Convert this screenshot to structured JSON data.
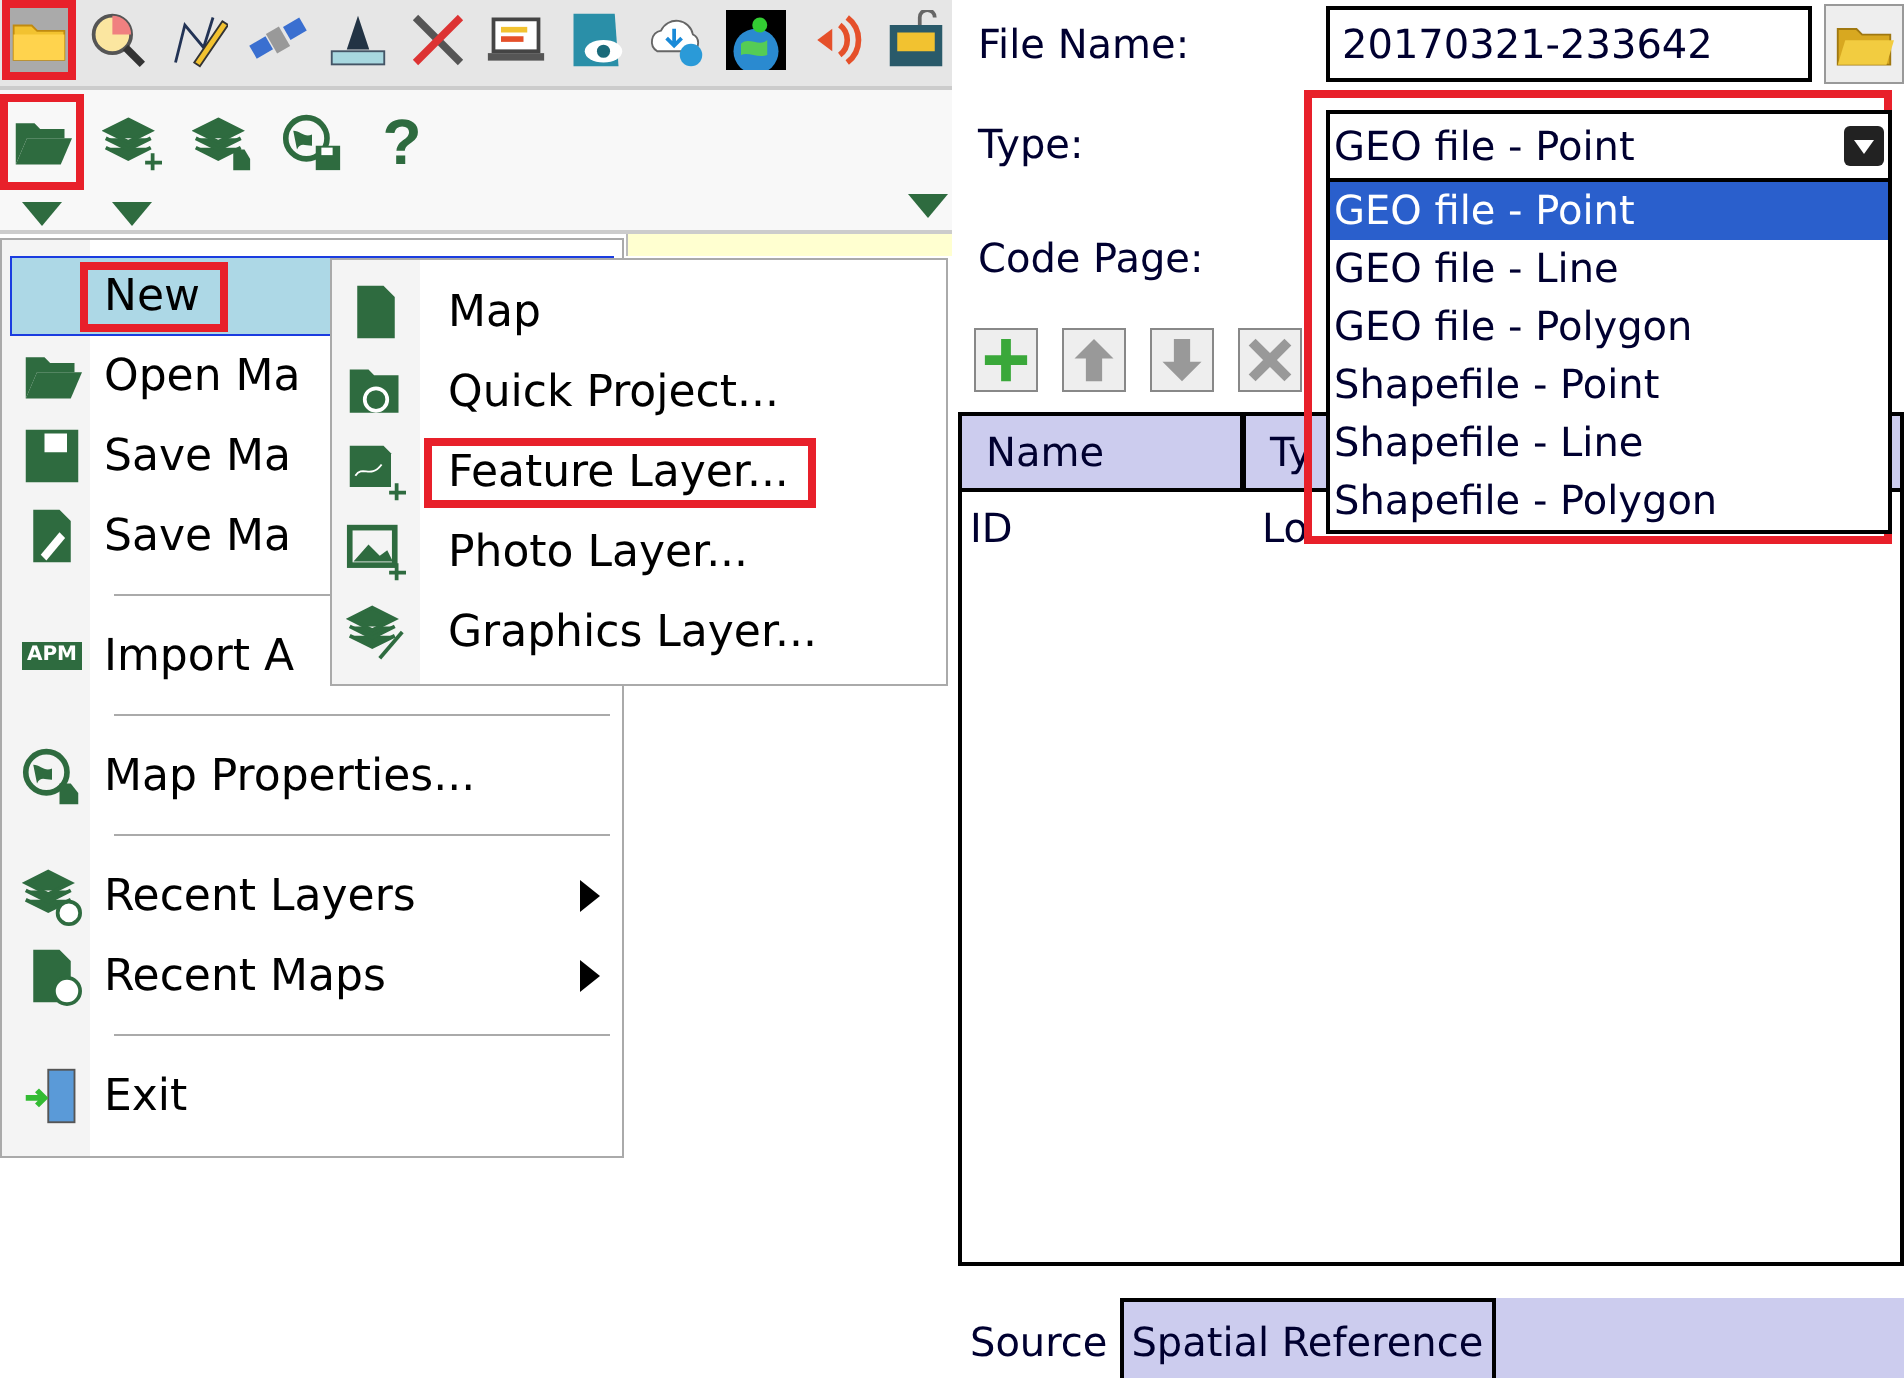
{
  "toolbar_top": [
    {
      "kind": "folder",
      "highlighted": true
    },
    {
      "kind": "magnifier",
      "highlighted": false
    },
    {
      "kind": "pencil",
      "highlighted": false
    },
    {
      "kind": "satellite",
      "highlighted": false
    },
    {
      "kind": "ruler",
      "highlighted": false
    },
    {
      "kind": "tools",
      "highlighted": false
    },
    {
      "kind": "laptop",
      "highlighted": false
    },
    {
      "kind": "eye",
      "highlighted": false
    },
    {
      "kind": "cloud",
      "highlighted": false
    },
    {
      "kind": "globe",
      "highlighted": false
    },
    {
      "kind": "signal",
      "highlighted": false
    },
    {
      "kind": "lock",
      "highlighted": false
    }
  ],
  "toolbar_second": [
    {
      "kind": "folder-open",
      "highlighted": true,
      "dropdown": true
    },
    {
      "kind": "layers-add",
      "highlighted": false,
      "dropdown": true
    },
    {
      "kind": "layers-edit",
      "highlighted": false,
      "dropdown": false
    },
    {
      "kind": "globe-save",
      "highlighted": false,
      "dropdown": false
    },
    {
      "kind": "help",
      "label": "?",
      "highlighted": false,
      "dropdown": false
    }
  ],
  "file_menu": {
    "items": [
      {
        "kind": "new",
        "label": "New",
        "selected": true,
        "highlighted": true,
        "has_submenu": false
      },
      {
        "kind": "folder",
        "label": "Open Ma",
        "selected": false,
        "highlighted": false,
        "has_submenu": false
      },
      {
        "kind": "save",
        "label": "Save Ma",
        "selected": false,
        "highlighted": false,
        "has_submenu": false
      },
      {
        "kind": "edit",
        "label": "Save Ma",
        "selected": false,
        "highlighted": false,
        "has_submenu": false
      },
      {
        "kind": "separator"
      },
      {
        "kind": "apm",
        "icon_text": "APM",
        "label": "Import A",
        "selected": false,
        "highlighted": false,
        "has_submenu": false
      },
      {
        "kind": "separator"
      },
      {
        "kind": "globe",
        "label": "Map Properties...",
        "selected": false,
        "highlighted": false,
        "has_submenu": false
      },
      {
        "kind": "separator"
      },
      {
        "kind": "layers-clock",
        "label": "Recent Layers",
        "selected": false,
        "highlighted": false,
        "has_submenu": true
      },
      {
        "kind": "document-clock",
        "label": "Recent Maps",
        "selected": false,
        "highlighted": false,
        "has_submenu": true
      },
      {
        "kind": "separator"
      },
      {
        "kind": "exit",
        "label": "Exit",
        "selected": false,
        "highlighted": false,
        "has_submenu": false
      }
    ]
  },
  "new_submenu": {
    "items": [
      {
        "kind": "document",
        "label": "Map",
        "highlighted": false
      },
      {
        "kind": "folder-clock",
        "label": "Quick Project...",
        "highlighted": false
      },
      {
        "kind": "feature",
        "label": "Feature Layer...",
        "highlighted": true
      },
      {
        "kind": "photo",
        "label": "Photo Layer...",
        "highlighted": false
      },
      {
        "kind": "layers-brush",
        "label": "Graphics Layer...",
        "highlighted": false
      }
    ]
  },
  "form": {
    "file_name": {
      "label": "File Name:",
      "value": "20170321-233642"
    },
    "type": {
      "label": "Type:",
      "value": "GEO file - Point",
      "highlighted": true,
      "expanded": true,
      "options": [
        {
          "label": "GEO file - Point",
          "selected": true
        },
        {
          "label": "GEO file - Line",
          "selected": false
        },
        {
          "label": "GEO file - Polygon",
          "selected": false
        },
        {
          "label": "Shapefile - Point",
          "selected": false
        },
        {
          "label": "Shapefile - Line",
          "selected": false
        },
        {
          "label": "Shapefile - Polygon",
          "selected": false
        }
      ]
    },
    "code_page": {
      "label": "Code Page:"
    }
  },
  "field_toolbar": [
    {
      "kind": "add",
      "disabled": false
    },
    {
      "kind": "up",
      "disabled": true
    },
    {
      "kind": "down",
      "disabled": true
    },
    {
      "kind": "delete",
      "disabled": true
    }
  ],
  "table": {
    "columns": [
      "Name",
      "Ty"
    ],
    "rows": [
      [
        "ID",
        "Lo"
      ]
    ]
  },
  "tabs": [
    {
      "label": "Source",
      "selected": true
    },
    {
      "label": "Spatial Reference",
      "selected": false
    }
  ]
}
